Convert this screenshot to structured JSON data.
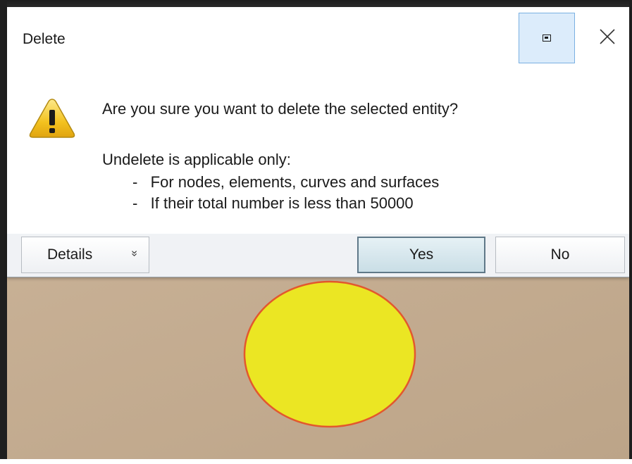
{
  "dialog": {
    "title": "Delete",
    "restore_icon": "restore-window-icon",
    "close_icon": "close-icon",
    "warning_icon": "warning-triangle-icon",
    "message": "Are you sure you want to delete the selected entity?",
    "sub_message": "Undelete is applicable only:",
    "bullets": [
      "-   For nodes, elements, curves and surfaces",
      "-   If their total number is less than 50000"
    ],
    "buttons": {
      "details": "Details",
      "details_chevron": "»",
      "yes": "Yes",
      "no": "No"
    }
  },
  "viewport": {
    "background_color": "#c4ab8e",
    "shape": "circle",
    "shape_fill": "#ebe623",
    "shape_stroke": "#e2582e"
  }
}
